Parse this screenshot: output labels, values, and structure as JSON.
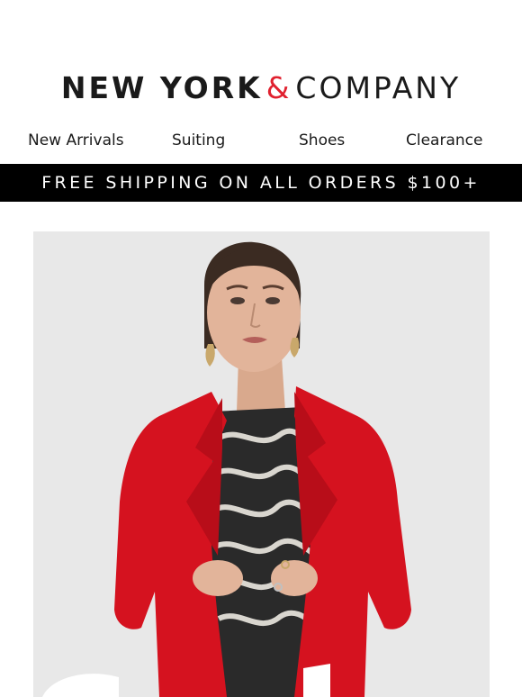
{
  "brand": {
    "name_bold": "NEW YORK",
    "ampersand": "&",
    "name_light": "COMPANY",
    "accent_color": "#e0212f"
  },
  "nav": {
    "items": [
      {
        "label": "New Arrivals"
      },
      {
        "label": "Suiting"
      },
      {
        "label": "Shoes"
      },
      {
        "label": "Clearance"
      }
    ]
  },
  "banner": {
    "text": "FREE SHIPPING ON ALL ORDERS $100+"
  },
  "hero": {
    "image": "model in red blazer",
    "blazer_color": "#d5121f",
    "background_color": "#e9e9e9"
  }
}
